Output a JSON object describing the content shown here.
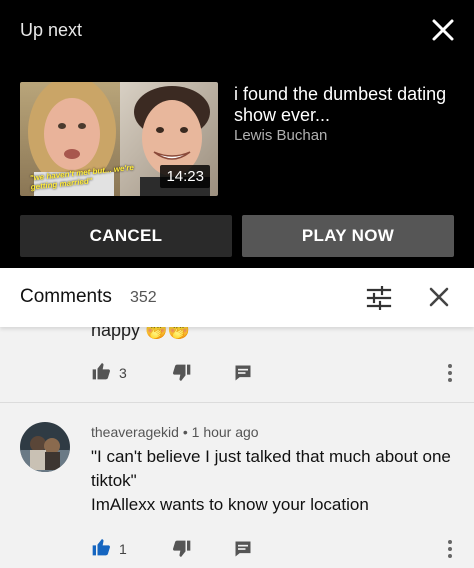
{
  "up_next": {
    "label": "Up next",
    "video": {
      "title": "i found the dumbest dating show ever...",
      "channel": "Lewis Buchan",
      "duration": "14:23",
      "thumbnail_caption": "\"we haven't met but... we're getting married\""
    },
    "cancel_label": "CANCEL",
    "play_label": "PLAY NOW"
  },
  "comments": {
    "title": "Comments",
    "count": "352",
    "items": [
      {
        "partial_text": "happy 🤭🤭",
        "likes": "3"
      },
      {
        "author": "theaveragekid",
        "separator": "•",
        "time": "1 hour ago",
        "text_line1": "\"I can't believe I just talked that much about one tiktok\"",
        "text_line2": "ImAllexx wants to know your location",
        "likes": "1",
        "liked": true
      }
    ]
  },
  "colors": {
    "accent_like": "#1565c0",
    "header_bg": "#000000",
    "body_bg": "#f2f2f2"
  },
  "icons": [
    "close-icon",
    "filter-icon",
    "thumbs-up-icon",
    "thumbs-down-icon",
    "reply-icon",
    "more-vert-icon"
  ]
}
